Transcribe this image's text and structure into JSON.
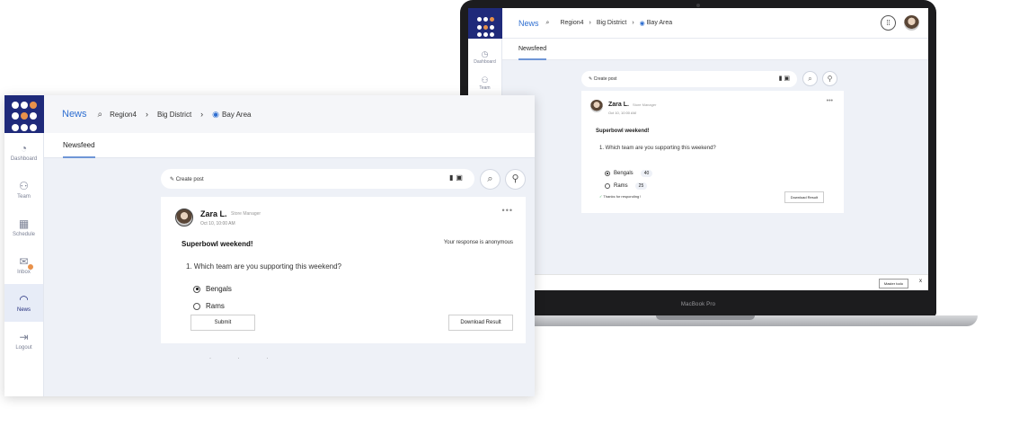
{
  "small_app": {
    "topbar": {
      "title": "News",
      "region": "Region4",
      "district": "Big District",
      "location": "Bay Area"
    },
    "nav": [
      {
        "label": "Dashboard",
        "icon": "dashboard-icon"
      },
      {
        "label": "Team",
        "icon": "team-icon"
      }
    ],
    "tab": "Newsfeed",
    "create_post": "Create post",
    "post": {
      "author": "Zara L.",
      "role": "Store Manager",
      "date": "Oct 10, 10:00 AM",
      "title": "Superbowl weekend!",
      "question": "1. Which team are you supporting this weekend?",
      "options": [
        {
          "label": "Bengals",
          "count": "40"
        },
        {
          "label": "Rams",
          "count": "25"
        }
      ],
      "thanks": "Thanks for responding !",
      "download_label": "Download Result"
    },
    "bottom_button": "Master todo",
    "bottom_close": "x"
  },
  "device_label": "MacBook Pro",
  "app": {
    "topbar": {
      "title": "News",
      "region": "Region4",
      "district": "Big District",
      "location": "Bay Area"
    },
    "nav": [
      {
        "label": "Dashboard",
        "icon": "dashboard-icon"
      },
      {
        "label": "Team",
        "icon": "team-icon"
      },
      {
        "label": "Schedule",
        "icon": "calendar-icon"
      },
      {
        "label": "Inbox",
        "icon": "inbox-icon"
      },
      {
        "label": "News",
        "icon": "rss-icon",
        "active": true
      },
      {
        "label": "Logout",
        "icon": "logout-icon"
      }
    ],
    "tab": "Newsfeed",
    "create_post": "Create post",
    "post": {
      "author": "Zara L.",
      "role": "Store Manager",
      "date": "Oct 10, 10:00 AM",
      "title": "Superbowl weekend!",
      "anonymous_note": "Your response is anonymous",
      "question": "1. Which team are you supporting this weekend?",
      "options": [
        {
          "label": "Bengals",
          "selected": true
        },
        {
          "label": "Rams",
          "selected": false
        }
      ],
      "submit_label": "Submit",
      "download_label": "Download Result"
    }
  },
  "colors": {
    "brand": "#1f2a7a",
    "accent": "#2f6fd1",
    "logo_dot": "#e8914a",
    "background": "#eef1f7"
  }
}
